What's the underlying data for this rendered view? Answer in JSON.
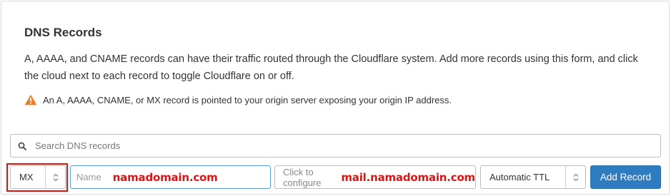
{
  "section": {
    "title": "DNS Records",
    "description": "A, AAAA, and CNAME records can have their traffic routed through the Cloudflare system. Add more records using this form, and click the cloud next to each record to toggle Cloudflare on or off.",
    "warning_text": "An A, AAAA, CNAME, or MX record is pointed to your origin server exposing your origin IP address."
  },
  "search": {
    "placeholder": "Search DNS records"
  },
  "form": {
    "type_value": "MX",
    "name_placeholder": "Name",
    "name_annotation": "namadomain.com",
    "content_placeholder": "Click to configure",
    "content_annotation": "mail.namadomain.com",
    "ttl_value": "Automatic TTL",
    "add_button_label": "Add Record"
  },
  "colors": {
    "warning_icon": "#e8812c",
    "annotation_red": "#dd1414",
    "primary_button": "#2f7bbf",
    "focus_border": "#5d9ccf"
  },
  "icons": {
    "warning": "warning-triangle-icon",
    "search": "search-icon",
    "stepper": "chevron-up-down-icon"
  }
}
